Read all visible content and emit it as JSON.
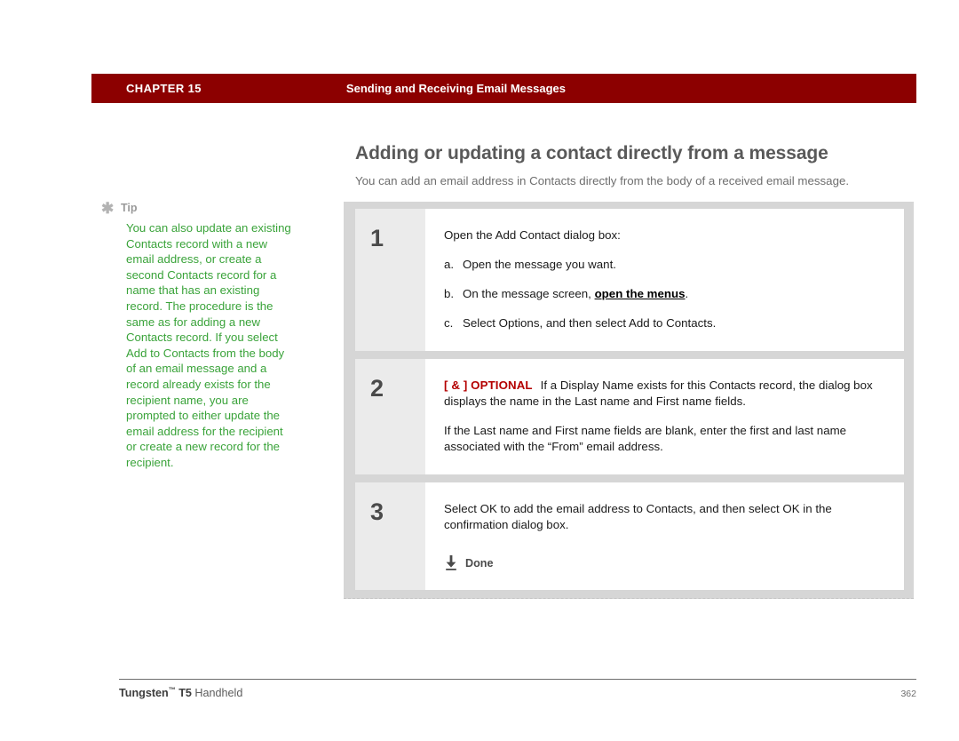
{
  "header": {
    "chapter": "CHAPTER 15",
    "section": "Sending and Receiving Email Messages",
    "bar_color": "#8c0000"
  },
  "title": {
    "heading": "Adding or updating a contact directly from a message",
    "subheading": "You can add an email address in Contacts directly from the body of a received email message."
  },
  "tip": {
    "icon": "asterisk-icon",
    "label": "Tip",
    "body": "You can also update an existing Contacts record with a new email address, or create a second Contacts record for a name that has an existing record. The procedure is the same as for adding a new Contacts record. If you select Add to Contacts from the body of an email message and a record already exists for the recipient name, you are prompted to either update the email address for the recipient or create a new record for the recipient.",
    "text_color": "#3aa33a"
  },
  "steps": [
    {
      "number": "1",
      "intro": "Open the Add Contact dialog box:",
      "substeps": [
        {
          "marker": "a.",
          "text_before": "Open the message you want.",
          "link": "",
          "text_after": ""
        },
        {
          "marker": "b.",
          "text_before": "On the message screen, ",
          "link": "open the menus",
          "text_after": "."
        },
        {
          "marker": "c.",
          "text_before": "Select Options, and then select Add to Contacts.",
          "link": "",
          "text_after": ""
        }
      ]
    },
    {
      "number": "2",
      "optional_brackets": "[ & ]",
      "optional_tag": "OPTIONAL",
      "optional_text": "If a Display Name exists for this Contacts record, the dialog box displays the name in the Last name and First name fields.",
      "second_paragraph": "If the Last name and First name fields are blank, enter the first and last name associated with the “From” email address.",
      "tag_color": "#b40000"
    },
    {
      "number": "3",
      "intro": "Select OK to add the email address to Contacts, and then select OK in the confirmation dialog box.",
      "done_icon": "down-arrow-to-bar-icon",
      "done_label": "Done"
    }
  ],
  "footer": {
    "brand": "Tungsten",
    "trademark": "™",
    "model": " T5",
    "product": " Handheld",
    "page_number": "362"
  }
}
